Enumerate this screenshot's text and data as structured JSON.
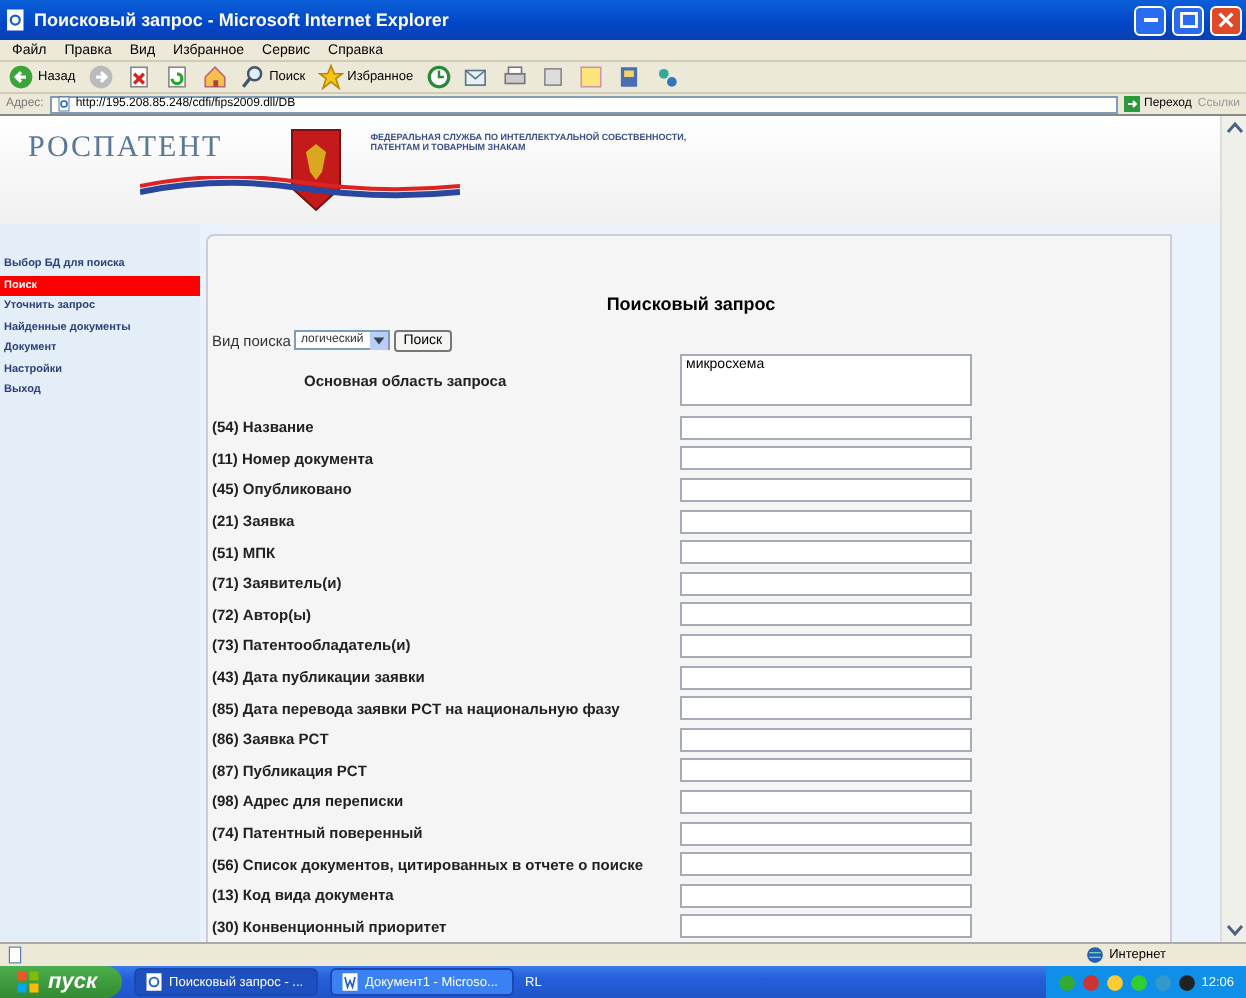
{
  "window": {
    "title": "Поисковый запрос - Microsoft Internet Explorer"
  },
  "menu_bar": [
    "Файл",
    "Правка",
    "Вид",
    "Избранное",
    "Сервис",
    "Справка"
  ],
  "toolbar": [
    {
      "kind": "back",
      "label": "Назад"
    },
    {
      "kind": "forward"
    },
    {
      "kind": "stop"
    },
    {
      "kind": "refresh"
    },
    {
      "kind": "home"
    },
    {
      "kind": "search",
      "label": "Поиск"
    },
    {
      "kind": "favorites",
      "label": "Избранное"
    },
    {
      "kind": "history"
    },
    {
      "kind": "mail"
    },
    {
      "kind": "print"
    },
    {
      "kind": "edit"
    },
    {
      "kind": "note"
    },
    {
      "kind": "messenger"
    },
    {
      "kind": "network"
    }
  ],
  "address_bar": {
    "label": "Адрес:",
    "value": "http://195.208.85.248/cdfi/fips2009.dll/DB",
    "go_button": "Переход",
    "links": "Ссылки"
  },
  "banner": {
    "logo": "РОСПАТЕНТ",
    "agency": [
      "ФЕДЕРАЛЬНАЯ СЛУЖБА ПО ИНТЕЛЛЕКТУАЛЬНОЙ СОБСТВЕННОСТИ,",
      "ПАТЕНТАМ И ТОВАРНЫМ ЗНАКАМ"
    ]
  },
  "sidebar": {
    "items": [
      {
        "label": "Выбор БД для поиска",
        "selected": false
      },
      {
        "label": "Поиск",
        "selected": true
      },
      {
        "label": "Уточнить запрос",
        "selected": false
      },
      {
        "label": "Найденные документы",
        "selected": false
      },
      {
        "label": "Документ",
        "selected": false
      },
      {
        "label": "Настройки",
        "selected": false
      },
      {
        "label": "Выход",
        "selected": false
      }
    ]
  },
  "form": {
    "title": "Поисковый запрос",
    "search_type": {
      "label": "Вид поиска",
      "value": "логический"
    },
    "search_button": "Поиск",
    "main_field": {
      "label": "Основная область запроса",
      "value": "микросхема"
    },
    "fields": [
      {
        "label": "(54) Название"
      },
      {
        "label": "(11) Номер документа"
      },
      {
        "label": "(45) Опубликовано"
      },
      {
        "label": "(21) Заявка"
      },
      {
        "label": "(51) МПК"
      },
      {
        "label": "(71) Заявитель(и)"
      },
      {
        "label": "(72) Автор(ы)"
      },
      {
        "label": "(73) Патентообладатель(и)"
      },
      {
        "label": "(43) Дата публикации заявки"
      },
      {
        "label": "(85) Дата перевода заявки PCT на национальную фазу"
      },
      {
        "label": "(86) Заявка PCT"
      },
      {
        "label": "(87) Публикация PCT"
      },
      {
        "label": "(98) Адрес для переписки"
      },
      {
        "label": "(74) Патентный поверенный"
      },
      {
        "label": "(56) Список документов, цитированных в отчете о поиске"
      },
      {
        "label": "(13) Код вида документа"
      },
      {
        "label": "(30) Конвенционный приоритет"
      }
    ]
  },
  "status_bar": {
    "zone": "Интернет"
  },
  "taskbar": {
    "start": "пуск",
    "tasks": [
      {
        "label": "Поисковый запрос - ...",
        "selected": true
      },
      {
        "label": "Документ1 - Microso...",
        "selected": false
      }
    ],
    "language": "RL",
    "clock": "12:06"
  }
}
